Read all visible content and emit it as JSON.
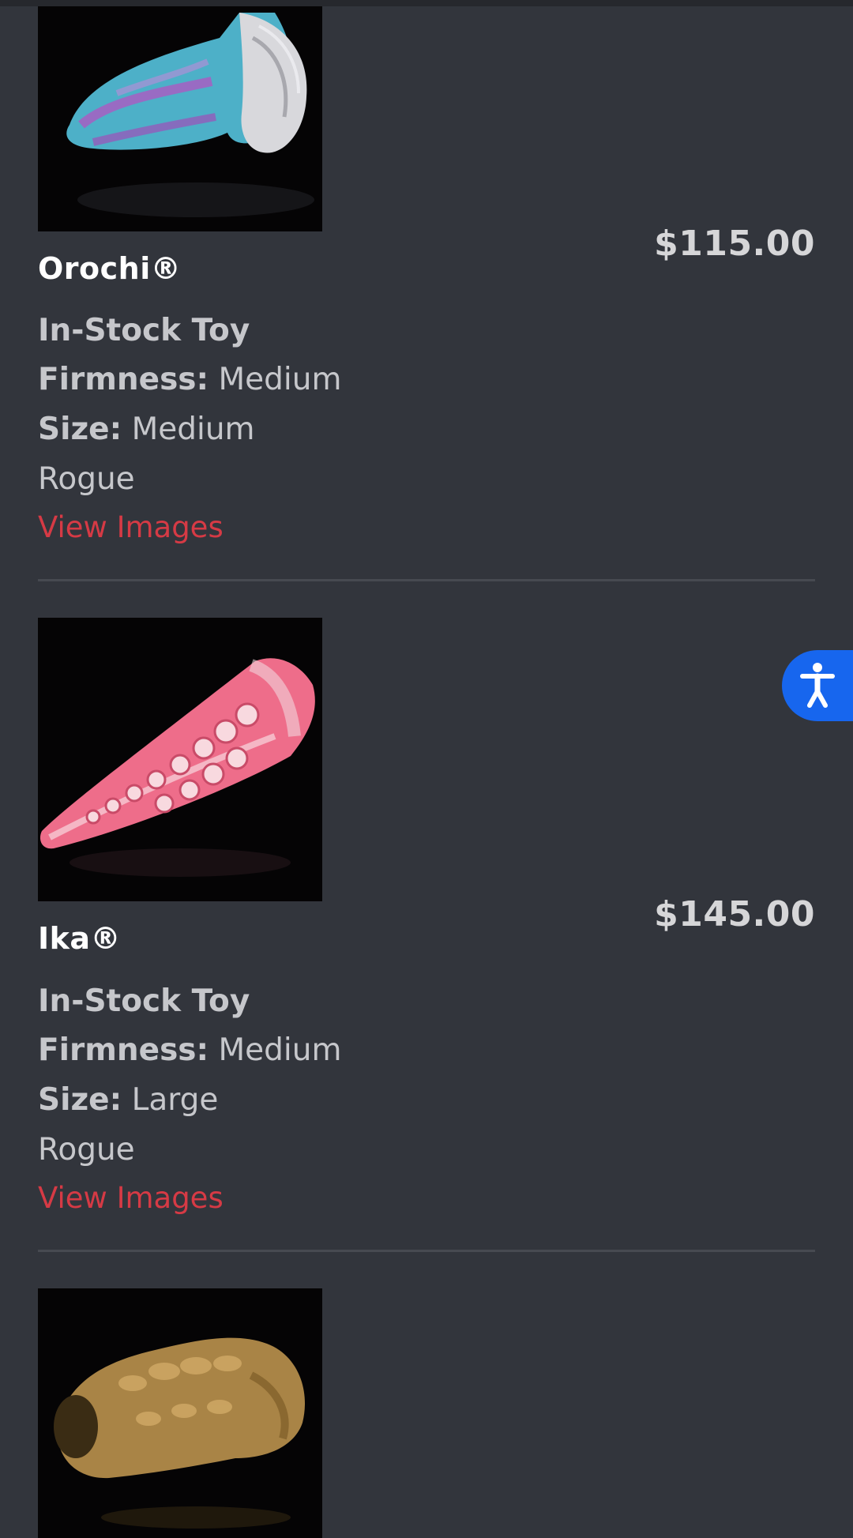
{
  "products": [
    {
      "name": "Orochi®",
      "price": "$115.00",
      "stock": "In-Stock Toy",
      "firmness_label": "Firmness:",
      "firmness": "Medium",
      "size_label": "Size:",
      "size": "Medium",
      "colorway": "Rogue",
      "link": "View Images"
    },
    {
      "name": "Ika®",
      "price": "$145.00",
      "stock": "In-Stock Toy",
      "firmness_label": "Firmness:",
      "firmness": "Medium",
      "size_label": "Size:",
      "size": "Large",
      "colorway": "Rogue",
      "link": "View Images"
    }
  ],
  "accessibility": {
    "icon": "accessibility-icon",
    "color": "#1766ee"
  },
  "colors": {
    "background": "#32353c",
    "link": "#d63a45",
    "title": "#ffffff",
    "text": "#c6c7cb"
  }
}
